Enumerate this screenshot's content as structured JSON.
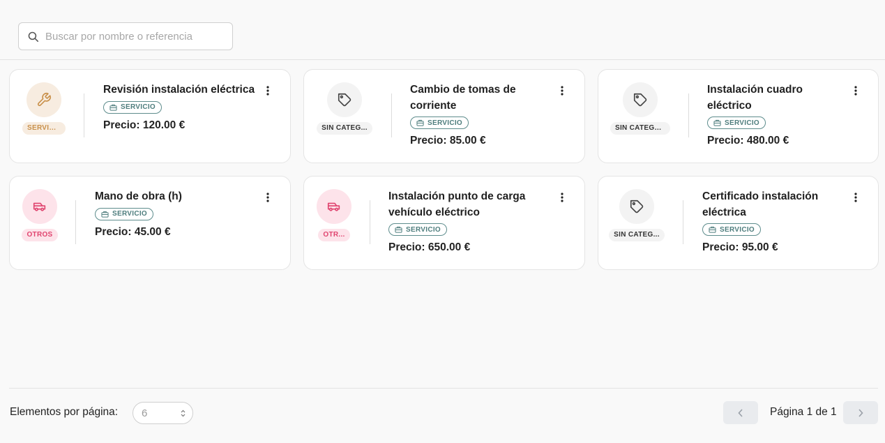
{
  "search": {
    "placeholder": "Buscar por nombre o referencia",
    "icon": "search-icon"
  },
  "colors": {
    "service_cat_bg": "#f7ece0",
    "service_cat_fg": "#c9904a",
    "none_cat_bg": "#f3f3f3",
    "none_cat_fg": "#444444",
    "otros_cat_bg": "#fde3ea",
    "otros_cat_fg": "#e0446f",
    "type_badge": "#4e7d7d"
  },
  "products": [
    {
      "title": "Revisión instalación eléctrica",
      "category": "SERVICI...",
      "category_icon": "wrench-icon",
      "type": "SERVICIO",
      "price": "Precio: 120.00 €"
    },
    {
      "title": "Cambio de tomas de corriente",
      "category": "SIN CATEG...",
      "category_icon": "tag-icon",
      "type": "SERVICIO",
      "price": "Precio: 85.00 €"
    },
    {
      "title": "Instalación cuadro eléctrico",
      "category": "SIN CATEGO...",
      "category_icon": "tag-icon",
      "type": "SERVICIO",
      "price": "Precio: 480.00 €"
    },
    {
      "title": "Mano de obra (h)",
      "category": "OTROS",
      "category_icon": "van-icon",
      "type": "SERVICIO",
      "price": "Precio: 45.00 €"
    },
    {
      "title": "Instalación punto de carga vehículo eléctrico",
      "category": "OTR...",
      "category_icon": "van-icon",
      "type": "SERVICIO",
      "price": "Precio: 650.00 €"
    },
    {
      "title": "Certificado instalación eléctrica",
      "category": "SIN CATEG...",
      "category_icon": "tag-icon",
      "type": "SERVICIO",
      "price": "Precio: 95.00 €"
    }
  ],
  "pagination": {
    "per_page_label": "Elementos por página:",
    "per_page_value": "6",
    "page_label": "Página 1 de 1",
    "prev_icon": "chevron-left-icon",
    "next_icon": "chevron-right-icon"
  }
}
